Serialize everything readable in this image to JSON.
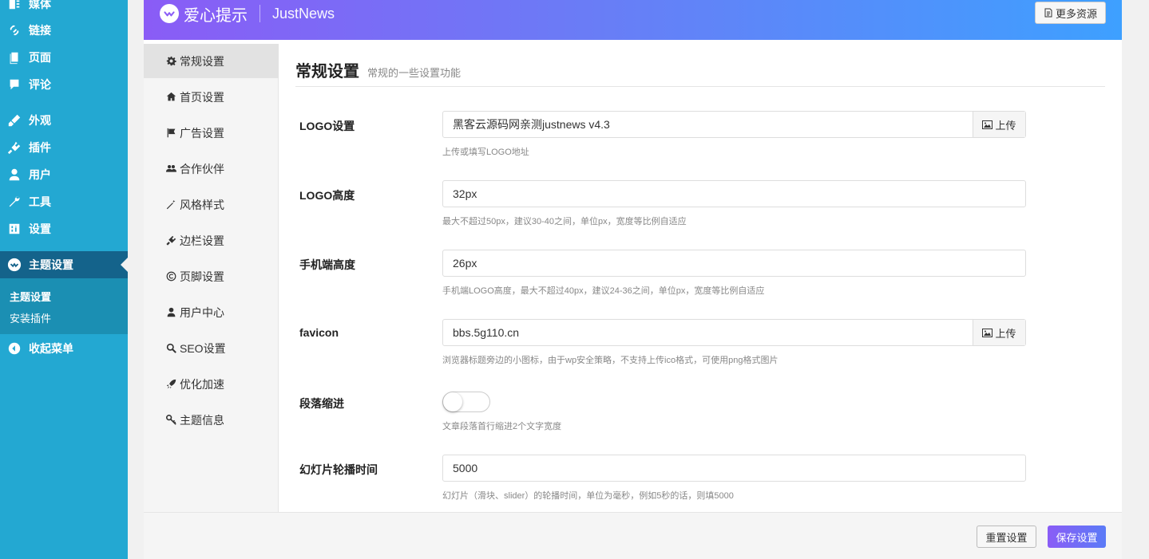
{
  "wp_menu": {
    "items": [
      {
        "label": "媒体",
        "icon": "media-icon"
      },
      {
        "label": "链接",
        "icon": "link-icon"
      },
      {
        "label": "页面",
        "icon": "page-icon"
      },
      {
        "label": "评论",
        "icon": "comment-icon"
      },
      {
        "label": "外观",
        "icon": "appearance-icon"
      },
      {
        "label": "插件",
        "icon": "plugin-icon"
      },
      {
        "label": "用户",
        "icon": "user-icon"
      },
      {
        "label": "工具",
        "icon": "wrench-icon"
      },
      {
        "label": "设置",
        "icon": "settings-icon"
      },
      {
        "label": "主题设置",
        "icon": "heart-logo-icon"
      }
    ],
    "submenu": [
      "主题设置",
      "安装插件"
    ],
    "collapse_label": "收起菜单"
  },
  "header": {
    "brand": "爱心提示",
    "product": "JustNews",
    "more_resources": "更多资源"
  },
  "left_nav": [
    {
      "label": "常规设置",
      "icon": "gear-icon"
    },
    {
      "label": "首页设置",
      "icon": "home-icon"
    },
    {
      "label": "广告设置",
      "icon": "flag-icon"
    },
    {
      "label": "合作伙伴",
      "icon": "users-icon"
    },
    {
      "label": "风格样式",
      "icon": "magic-icon"
    },
    {
      "label": "边栏设置",
      "icon": "plug-icon"
    },
    {
      "label": "页脚设置",
      "icon": "copyright-icon"
    },
    {
      "label": "用户中心",
      "icon": "user-icon"
    },
    {
      "label": "SEO设置",
      "icon": "search-icon"
    },
    {
      "label": "优化加速",
      "icon": "rocket-icon"
    },
    {
      "label": "主题信息",
      "icon": "key-icon"
    }
  ],
  "section": {
    "title": "常规设置",
    "desc": "常规的一些设置功能"
  },
  "fields": {
    "logo": {
      "label": "LOGO设置",
      "value": "黑客云源码网亲测justnews v4.3",
      "help": "上传或填写LOGO地址",
      "upload": "上传"
    },
    "logo_height": {
      "label": "LOGO高度",
      "value": "32px",
      "help": "最大不超过50px，建议30-40之间，单位px，宽度等比例自适应"
    },
    "mobile_height": {
      "label": "手机端高度",
      "value": "26px",
      "help": "手机端LOGO高度，最大不超过40px，建议24-36之间，单位px，宽度等比例自适应"
    },
    "favicon": {
      "label": "favicon",
      "value": "bbs.5g110.cn",
      "help": "浏览器标题旁边的小图标，由于wp安全策略，不支持上传ico格式，可使用png格式图片",
      "upload": "上传"
    },
    "indent": {
      "label": "段落缩进",
      "help": "文章段落首行缩进2个文字宽度"
    },
    "slider_time": {
      "label": "幻灯片轮播时间",
      "value": "5000",
      "help": "幻灯片（滑块、slider）的轮播时间，单位为毫秒，例如5秒的话，则填5000"
    }
  },
  "footer": {
    "reset": "重置设置",
    "save": "保存设置"
  },
  "colors": {
    "wp_sidebar": "#23a8d2",
    "wp_active": "#14638b",
    "accent_purple": "#8a5cf6",
    "accent_blue": "#3ea0ff"
  }
}
